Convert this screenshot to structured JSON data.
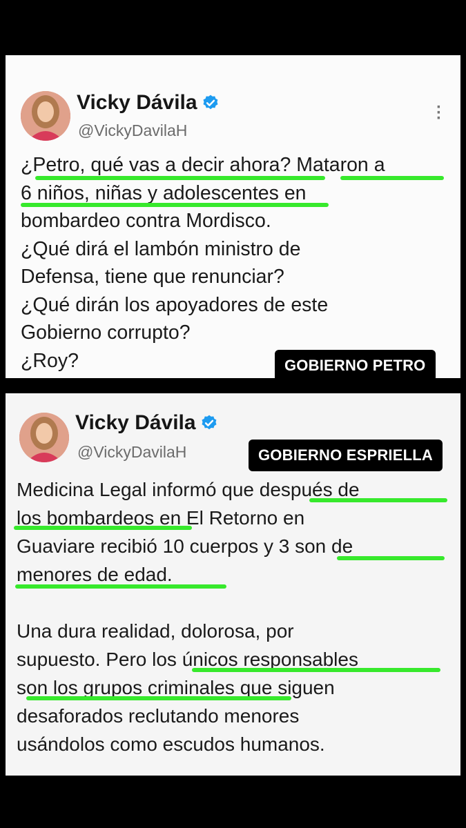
{
  "tweet1": {
    "author_name": "Vicky Dávila",
    "handle": "@VickyDavilaH",
    "lines": [
      "¿Petro, qué vas a decir ahora? Mataron a",
      "6 niños, niñas y adolescentes en",
      "bombardeo contra Mordisco.",
      "¿Qué dirá el lambón ministro de",
      "Defensa, tiene que renunciar?",
      "¿Qué dirán los apoyadores de este",
      "Gobierno corrupto?",
      "¿Roy?"
    ],
    "tag": "GOBIERNO PETRO"
  },
  "tweet2": {
    "author_name": "Vicky Dávila",
    "handle": "@VickyDavilaH",
    "lines": [
      "Medicina Legal informó que después de",
      "los bombardeos en El Retorno en",
      "Guaviare recibió 10 cuerpos y 3 son de",
      "menores de edad.",
      "",
      "Una dura realidad, dolorosa, por",
      "supuesto. Pero los únicos responsables",
      "son los grupos criminales que siguen",
      "desaforados reclutando menores",
      "usándolos como escudos humanos."
    ],
    "tag": "GOBIERNO ESPRIELLA"
  },
  "icons": {
    "verified": "verified-badge-icon",
    "more": "more-options-icon"
  },
  "colors": {
    "highlight": "#37e92c",
    "verified": "#1d9bf0",
    "tag_bg": "#000000"
  }
}
